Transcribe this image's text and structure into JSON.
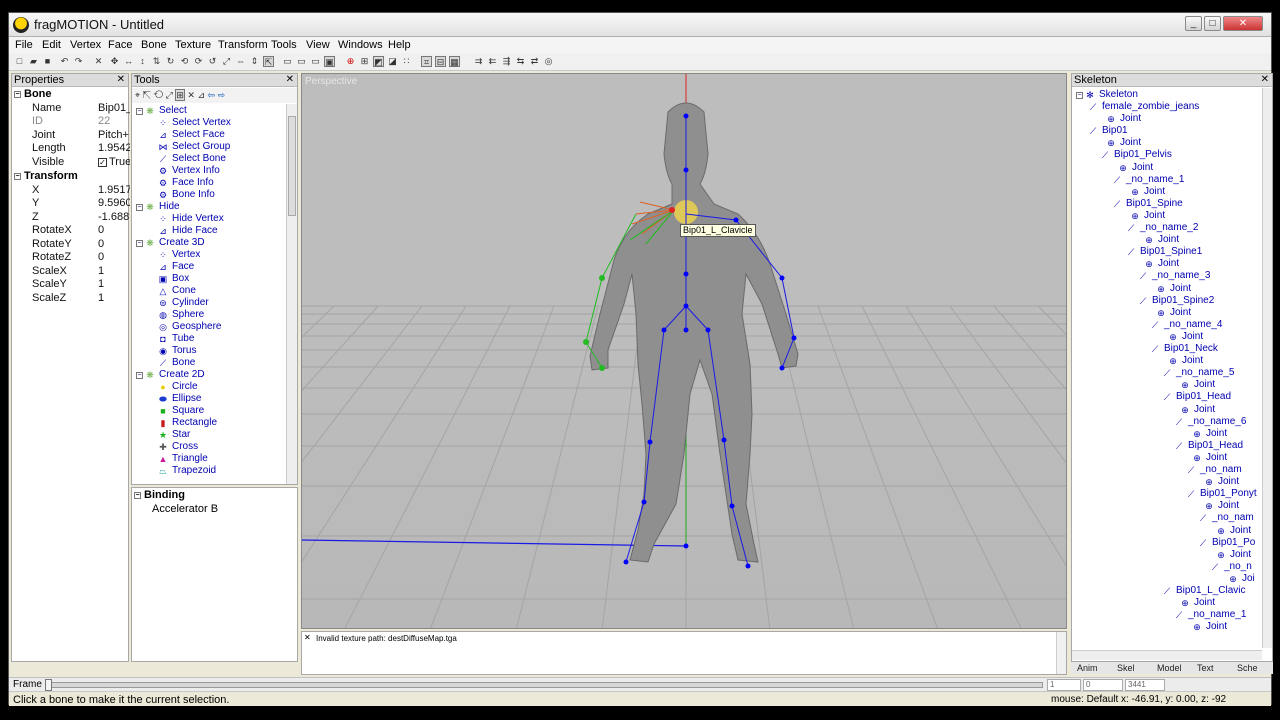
{
  "window": {
    "app_name": "fragMOTION",
    "title": "fragMOTION - Untitled",
    "min": "_",
    "max": "□",
    "close": "✕"
  },
  "menu": [
    "File",
    "Edit",
    "Vertex",
    "Face",
    "Bone",
    "Texture",
    "Transform",
    "Tools",
    "View",
    "Windows",
    "Help"
  ],
  "properties": {
    "title": "Properties",
    "group_bone": "Bone",
    "rows_bone": [
      {
        "name": "Name",
        "value": "Bip01_"
      },
      {
        "name": "ID",
        "value": "22"
      },
      {
        "name": "Joint",
        "value": "Pitch+"
      },
      {
        "name": "Length",
        "value": "1.9542"
      },
      {
        "name": "Visible",
        "value": "True"
      }
    ],
    "group_transform": "Transform",
    "rows_transform": [
      {
        "name": "X",
        "value": "1.9517"
      },
      {
        "name": "Y",
        "value": "9.5960"
      },
      {
        "name": "Z",
        "value": "-1.688"
      },
      {
        "name": "RotateX",
        "value": "0"
      },
      {
        "name": "RotateY",
        "value": "0"
      },
      {
        "name": "RotateZ",
        "value": "0"
      },
      {
        "name": "ScaleX",
        "value": "1"
      },
      {
        "name": "ScaleY",
        "value": "1"
      },
      {
        "name": "ScaleZ",
        "value": "1"
      }
    ]
  },
  "tools": {
    "title": "Tools",
    "categories": {
      "select": "Select",
      "hide": "Hide",
      "create3d": "Create 3D",
      "create2d": "Create 2D"
    },
    "select_items": [
      "Select Vertex",
      "Select Face",
      "Select Group",
      "Select Bone",
      "Vertex Info",
      "Face Info",
      "Bone Info"
    ],
    "hide_items": [
      "Hide Vertex",
      "Hide Face"
    ],
    "create3d_items": [
      "Vertex",
      "Face",
      "Box",
      "Cone",
      "Cylinder",
      "Sphere",
      "Geosphere",
      "Tube",
      "Torus",
      "Bone"
    ],
    "create2d_items": [
      "Circle",
      "Ellipse",
      "Square",
      "Rectangle",
      "Star",
      "Cross",
      "Triangle",
      "Trapezoid"
    ],
    "binding_title": "Binding",
    "binding_row": "Accelerator  B"
  },
  "viewport": {
    "label": "Perspective",
    "selected_bone": "Bip01_L_Clavicle"
  },
  "log": {
    "message": "Invalid texture path: destDiffuseMap.tga"
  },
  "skeleton": {
    "title": "Skeleton",
    "root": "Skeleton",
    "nodes": [
      "female_zombie_jeans",
      "Joint",
      "Bip01",
      "Joint",
      "Bip01_Pelvis",
      "Joint",
      "_no_name_1",
      "Joint",
      "Bip01_Spine",
      "Joint",
      "_no_name_2",
      "Joint",
      "Bip01_Spine1",
      "Joint",
      "_no_name_3",
      "Joint",
      "Bip01_Spine2",
      "Joint",
      "_no_name_4",
      "Joint",
      "Bip01_Neck",
      "Joint",
      "_no_name_5",
      "Joint",
      "Bip01_Head",
      "Joint",
      "_no_name_6",
      "Joint",
      "Bip01_Head",
      "Joint",
      "_no_nam",
      "Joint",
      "Bip01_Ponyt",
      "Joint",
      "_no_nam",
      "Joint",
      "Bip01_Po",
      "Joint",
      "_no_n",
      "Joi",
      "Bip01_L_Clavic",
      "Joint",
      "_no_name_1",
      "Joint"
    ],
    "tabs": [
      "Anim",
      "Skel",
      "Model",
      "Text",
      "Sche"
    ]
  },
  "frame": {
    "label": "Frame",
    "start": "1",
    "current": "0",
    "end": "3441"
  },
  "status": {
    "message": "Click a bone to make it the current selection.",
    "mouse": "mouse: Default   x: -46.91, y: 0.00, z: -92"
  },
  "colors": {
    "bone_line": "#1a1ae6",
    "bone_dot": "#0000ff",
    "selected": "#ffe040",
    "axis_red": "#dd2222",
    "axis_green": "#22aa22"
  }
}
